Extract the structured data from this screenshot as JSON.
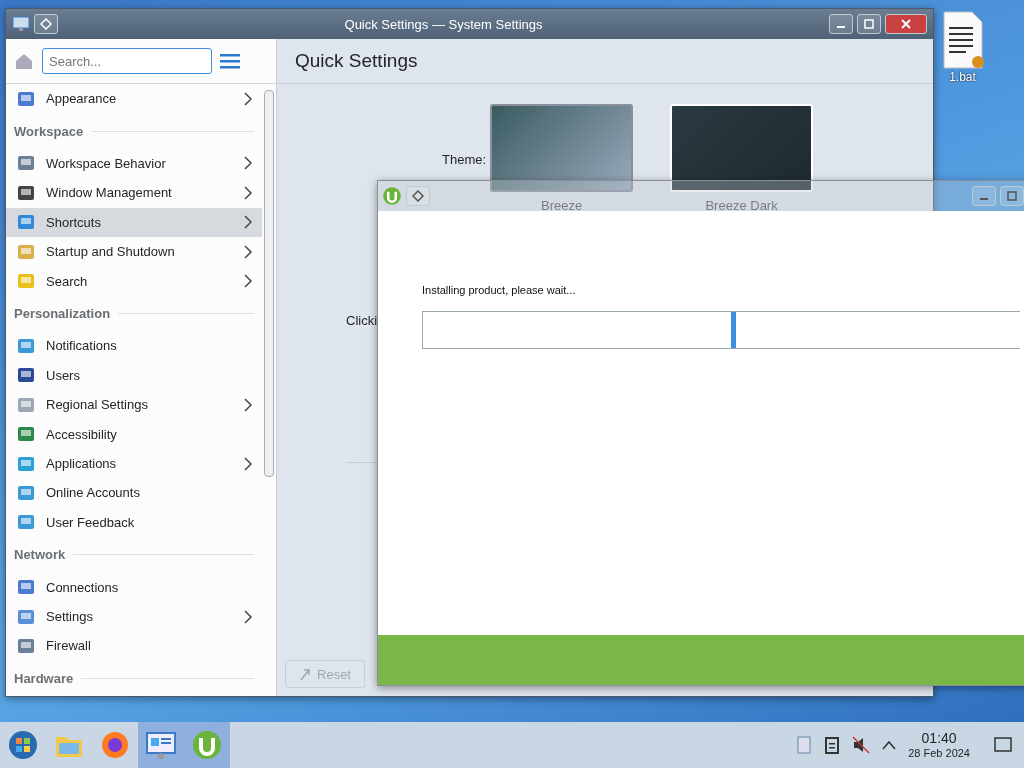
{
  "desktop": {
    "icons": [
      {
        "label": "1.bat"
      }
    ]
  },
  "settings_window": {
    "title": "Quick Settings — System Settings",
    "search": {
      "placeholder": "Search..."
    },
    "sidebar": [
      {
        "kind": "item",
        "label": "Appearance",
        "arrow": true,
        "selected": false
      },
      {
        "kind": "header",
        "label": "Workspace"
      },
      {
        "kind": "item",
        "label": "Workspace Behavior",
        "arrow": true,
        "selected": false
      },
      {
        "kind": "item",
        "label": "Window Management",
        "arrow": true,
        "selected": false
      },
      {
        "kind": "item",
        "label": "Shortcuts",
        "arrow": true,
        "selected": true
      },
      {
        "kind": "item",
        "label": "Startup and Shutdown",
        "arrow": true,
        "selected": false
      },
      {
        "kind": "item",
        "label": "Search",
        "arrow": true,
        "selected": false
      },
      {
        "kind": "header",
        "label": "Personalization"
      },
      {
        "kind": "item",
        "label": "Notifications",
        "arrow": false,
        "selected": false
      },
      {
        "kind": "item",
        "label": "Users",
        "arrow": false,
        "selected": false
      },
      {
        "kind": "item",
        "label": "Regional Settings",
        "arrow": true,
        "selected": false
      },
      {
        "kind": "item",
        "label": "Accessibility",
        "arrow": false,
        "selected": false
      },
      {
        "kind": "item",
        "label": "Applications",
        "arrow": true,
        "selected": false
      },
      {
        "kind": "item",
        "label": "Online Accounts",
        "arrow": false,
        "selected": false
      },
      {
        "kind": "item",
        "label": "User Feedback",
        "arrow": false,
        "selected": false
      },
      {
        "kind": "header",
        "label": "Network"
      },
      {
        "kind": "item",
        "label": "Connections",
        "arrow": false,
        "selected": false
      },
      {
        "kind": "item",
        "label": "Settings",
        "arrow": true,
        "selected": false
      },
      {
        "kind": "item",
        "label": "Firewall",
        "arrow": false,
        "selected": false
      },
      {
        "kind": "header",
        "label": "Hardware"
      }
    ],
    "page": {
      "title": "Quick Settings",
      "theme_label": "Theme:",
      "themes": [
        {
          "name": "Breeze",
          "dark": false,
          "selected": false
        },
        {
          "name": "Breeze Dark",
          "dark": true,
          "selected": true
        }
      ],
      "clipped_text": "Clicki",
      "reset_button": {
        "label": "Reset",
        "disabled": true
      }
    }
  },
  "installer_window": {
    "message": "Installing product, please wait...",
    "progress": {
      "busy": true
    }
  },
  "taskbar": {
    "apps": [
      {
        "kind": "start",
        "active": false
      },
      {
        "kind": "folder",
        "active": false
      },
      {
        "kind": "browser",
        "active": false
      },
      {
        "kind": "settings",
        "active": true
      },
      {
        "kind": "torrent",
        "active": true
      }
    ],
    "clock": {
      "time": "01:40",
      "date": "28 Feb 2024"
    }
  }
}
